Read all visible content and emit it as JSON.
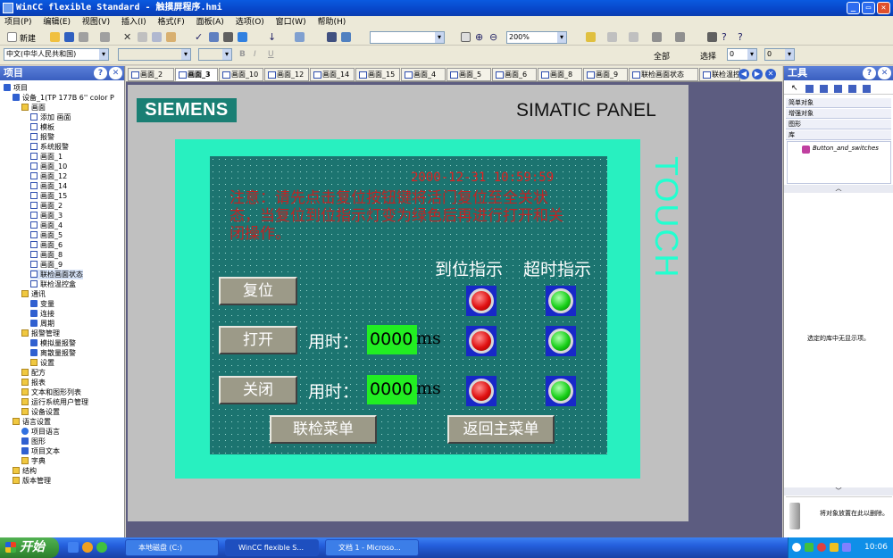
{
  "window": {
    "title": "WinCC flexible Standard - 触摸屏程序.hmi"
  },
  "menu": [
    "项目(P)",
    "编辑(E)",
    "视图(V)",
    "插入(I)",
    "格式(F)",
    "面板(A)",
    "选项(O)",
    "窗口(W)",
    "帮助(H)"
  ],
  "toolbar": {
    "new_label": "新建",
    "zoom": "200%",
    "all_label": "全部",
    "select_label": "选择",
    "value1": "0",
    "value2": "0"
  },
  "toolbar2": {
    "language": "中文(中华人民共和国)"
  },
  "project_pane": {
    "title": "项目",
    "tree": [
      {
        "label": "项目",
        "indent": 0,
        "icon": "ico-blue"
      },
      {
        "label": "设备_1(TP 177B 6'' color P",
        "indent": 1,
        "icon": "ico-blue"
      },
      {
        "label": "画面",
        "indent": 2,
        "icon": "ico-folder"
      },
      {
        "label": "添加 画面",
        "indent": 3,
        "icon": "ico-screen"
      },
      {
        "label": "模板",
        "indent": 3,
        "icon": "ico-screen"
      },
      {
        "label": "报警",
        "indent": 3,
        "icon": "ico-screen"
      },
      {
        "label": "系统报警",
        "indent": 3,
        "icon": "ico-screen"
      },
      {
        "label": "画面_1",
        "indent": 3,
        "icon": "ico-screen"
      },
      {
        "label": "画面_10",
        "indent": 3,
        "icon": "ico-screen"
      },
      {
        "label": "画面_12",
        "indent": 3,
        "icon": "ico-screen"
      },
      {
        "label": "画面_14",
        "indent": 3,
        "icon": "ico-screen"
      },
      {
        "label": "画面_15",
        "indent": 3,
        "icon": "ico-screen"
      },
      {
        "label": "画面_2",
        "indent": 3,
        "icon": "ico-screen"
      },
      {
        "label": "画面_3",
        "indent": 3,
        "icon": "ico-screen"
      },
      {
        "label": "画面_4",
        "indent": 3,
        "icon": "ico-screen"
      },
      {
        "label": "画面_5",
        "indent": 3,
        "icon": "ico-screen"
      },
      {
        "label": "画面_6",
        "indent": 3,
        "icon": "ico-screen"
      },
      {
        "label": "画面_8",
        "indent": 3,
        "icon": "ico-screen"
      },
      {
        "label": "画面_9",
        "indent": 3,
        "icon": "ico-screen"
      },
      {
        "label": "联检画面状态",
        "indent": 3,
        "icon": "ico-screen"
      },
      {
        "label": "联检温控盒",
        "indent": 3,
        "icon": "ico-screen"
      },
      {
        "label": "通讯",
        "indent": 2,
        "icon": "ico-folder"
      },
      {
        "label": "变量",
        "indent": 3,
        "icon": "ico-blue"
      },
      {
        "label": "连接",
        "indent": 3,
        "icon": "ico-blue"
      },
      {
        "label": "周期",
        "indent": 3,
        "icon": "ico-blue"
      },
      {
        "label": "报警管理",
        "indent": 2,
        "icon": "ico-folder"
      },
      {
        "label": "模拟量报警",
        "indent": 3,
        "icon": "ico-blue"
      },
      {
        "label": "离散量报警",
        "indent": 3,
        "icon": "ico-blue"
      },
      {
        "label": "设置",
        "indent": 3,
        "icon": "ico-folder"
      },
      {
        "label": "配方",
        "indent": 2,
        "icon": "ico-folder"
      },
      {
        "label": "报表",
        "indent": 2,
        "icon": "ico-folder"
      },
      {
        "label": "文本和图形列表",
        "indent": 2,
        "icon": "ico-folder"
      },
      {
        "label": "运行系统用户管理",
        "indent": 2,
        "icon": "ico-folder"
      },
      {
        "label": "设备设置",
        "indent": 2,
        "icon": "ico-folder"
      },
      {
        "label": "语言设置",
        "indent": 1,
        "icon": "ico-folder"
      },
      {
        "label": "项目语言",
        "indent": 2,
        "icon": "ico-globe"
      },
      {
        "label": "图形",
        "indent": 2,
        "icon": "ico-blue"
      },
      {
        "label": "项目文本",
        "indent": 2,
        "icon": "ico-blue"
      },
      {
        "label": "字典",
        "indent": 2,
        "icon": "ico-folder"
      },
      {
        "label": "结构",
        "indent": 1,
        "icon": "ico-folder"
      },
      {
        "label": "版本管理",
        "indent": 1,
        "icon": "ico-folder"
      }
    ]
  },
  "tabs": [
    "画面_2",
    "画面_3",
    "画面_10",
    "画面_12",
    "画面_14",
    "画面_15",
    "画面_4",
    "画面_5",
    "画面_6",
    "画面_8",
    "画面_9",
    "联检画面状态",
    "联检温控盒"
  ],
  "device": {
    "brand": "SIEMENS",
    "panel": "SIMATIC PANEL",
    "touch": "TOUCH",
    "datetime": "2000-12-31  10:59:59",
    "notice": "注意：请先点击复位按钮键将活门复位至全关状态，当复位到位指示灯变为绿色后再进行打开和关闭操作。",
    "header_inpos": "到位指示",
    "header_timeout": "超时指示",
    "reset_button": "复位",
    "open_button": "打开",
    "close_button": "关闭",
    "time_label": "用时：",
    "open_time": "0000",
    "close_time": "0000",
    "unit": "ms",
    "joint_menu_button": "联检菜单",
    "main_menu_button": "返回主菜单",
    "lamp_colors": {
      "red": "#e01010",
      "green": "#18d018"
    }
  },
  "tools_pane": {
    "title": "工具",
    "categories": [
      "简单对象",
      "增强对象",
      "图形",
      "库"
    ],
    "library_item": "Button_and_switches",
    "empty_lib_text": "选定的库中无显示项。",
    "drop_hint": "将对象放置在此以删除。"
  },
  "taskbar": {
    "start": "开始",
    "tasks": [
      "本地磁盘 (C:)",
      "WinCC flexible S...",
      "文档 1 - Microso..."
    ],
    "clock": "10:06"
  }
}
